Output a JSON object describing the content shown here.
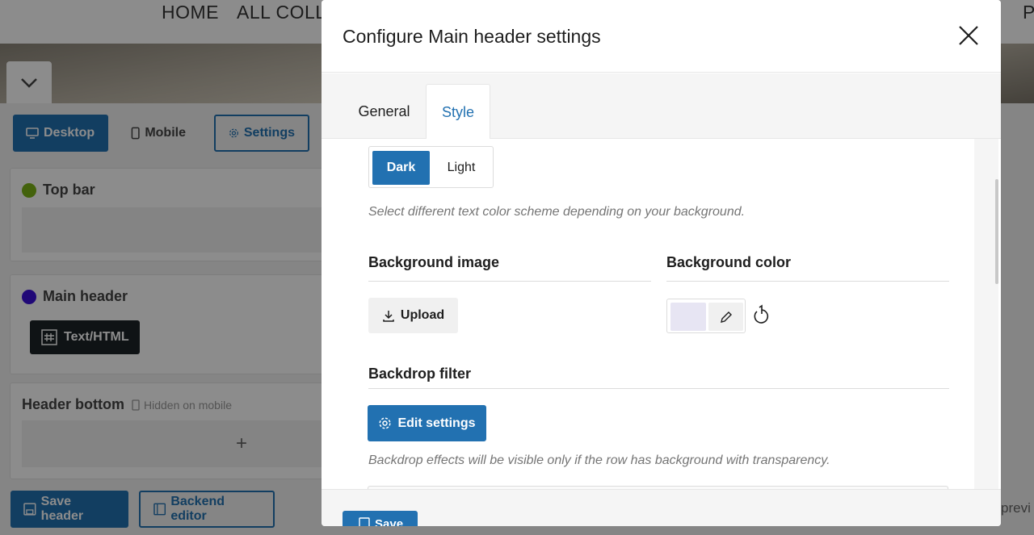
{
  "background": {
    "nav": [
      "HOME",
      "ALL COLLE",
      "P"
    ],
    "view_buttons": {
      "desktop": "Desktop",
      "mobile": "Mobile",
      "settings": "Settings"
    },
    "rows": {
      "top_bar": "Top bar",
      "main_header": "Main header",
      "header_bottom": "Header bottom",
      "hidden_on_mobile": "Hidden on mobile"
    },
    "element_chip": "Text/HTML",
    "add_symbol": "+",
    "save_header": "Save header",
    "backend_editor": "Backend editor",
    "preview_peek": "previ",
    "colors": {
      "top_bar_dot": "#7ab317",
      "main_header_dot": "#3b10d9",
      "primary": "#2271b1",
      "chip_bg": "#1d2327"
    }
  },
  "modal": {
    "title": "Configure Main header settings",
    "tabs": [
      {
        "label": "General",
        "active": false
      },
      {
        "label": "Style",
        "active": true
      }
    ],
    "text_scheme": {
      "options": [
        "Dark",
        "Light"
      ],
      "selected": "Dark",
      "help": "Select different text color scheme depending on your background."
    },
    "background_image": {
      "label": "Background image",
      "upload_label": "Upload"
    },
    "background_color": {
      "label": "Background color",
      "value": "#e7e5f3"
    },
    "backdrop_filter": {
      "label": "Backdrop filter",
      "button_label": "Edit settings",
      "help": "Backdrop effects will be visible only if the row has background with transparency."
    },
    "footer": {
      "save_label": "Save"
    }
  }
}
